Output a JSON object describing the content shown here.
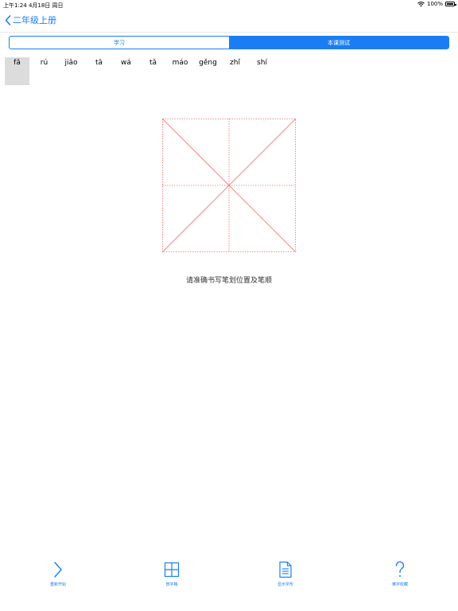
{
  "status_bar": {
    "time_date": "上午1:24  4月18日 周日",
    "battery_percent": "100%"
  },
  "nav": {
    "back_label": "二年级上册"
  },
  "segments": [
    {
      "label": "学习",
      "active": false
    },
    {
      "label": "本课测试",
      "active": true
    }
  ],
  "pinyin": [
    {
      "text": "fǎ",
      "selected": true
    },
    {
      "text": "rú",
      "selected": false
    },
    {
      "text": "jiǎo",
      "selected": false
    },
    {
      "text": "tā",
      "selected": false
    },
    {
      "text": "wá",
      "selected": false
    },
    {
      "text": "tǎ",
      "selected": false
    },
    {
      "text": "máo",
      "selected": false
    },
    {
      "text": "gěng",
      "selected": false
    },
    {
      "text": "zhǐ",
      "selected": false
    },
    {
      "text": "shí",
      "selected": false
    }
  ],
  "instruction": "请准确书写笔划位置及笔顺",
  "toolbar": {
    "restart_label": "重新开始",
    "grid_label": "田字格",
    "show_char_label": "显示字形",
    "difficult_label": "难字收藏"
  },
  "colors": {
    "accent": "#1a7ef2",
    "grid_line": "#ff6b6b",
    "selected_bg": "#dcdcdc"
  }
}
